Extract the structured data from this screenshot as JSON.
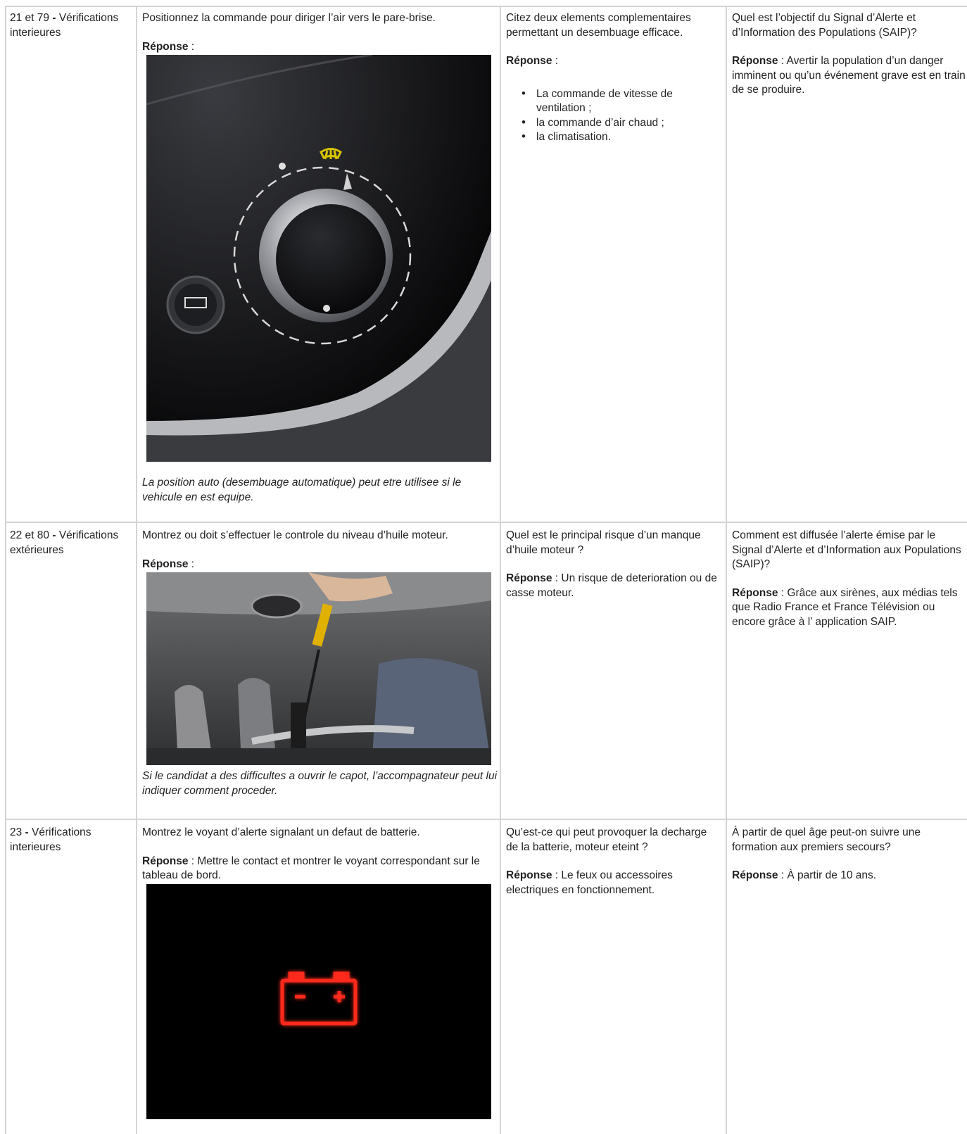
{
  "rows": [
    {
      "section_number": "21 et 79",
      "section_separator": " - ",
      "section_title": "Vérifications interieures",
      "interior_question": "Positionnez la commande pour diriger l’air vers le pare-brise.",
      "answer_label": "Réponse",
      "answer_suffix": " :",
      "image_icon": "defrost-dial-photo-icon",
      "caption": "La position auto (desembuage automatique) peut etre utilisee si le vehicule en est equipe.",
      "tech_question": "Citez deux elements complementaires permettant un desembuage efficace.",
      "tech_answer_label": "Réponse",
      "tech_answer_suffix": " :",
      "tech_answer_items": [
        "La commande de vitesse de ventilation ;",
        "la commande d’air chaud ;",
        "la climatisation."
      ],
      "safety_question": "Quel est l’objectif du Signal d’Alerte et d’Information des Populations (SAIP)?",
      "safety_answer_label": "Réponse",
      "safety_answer_text": " : Avertir la population d’un danger imminent ou qu’un événement grave est en train de se produire."
    },
    {
      "section_number": "22 et 80",
      "section_separator": " - ",
      "section_title": "Vérifications extérieures",
      "interior_question": "Montrez ou doit s’effectuer le controle du niveau d’huile moteur.",
      "answer_label": "Réponse",
      "answer_suffix": " :",
      "image_icon": "engine-oil-dipstick-photo-icon",
      "caption": "Si le candidat a des difficultes a ouvrir le capot, l’accompagnateur peut lui indiquer comment proceder.",
      "tech_question": "Quel est le principal risque d’un manque d’huile moteur ?",
      "tech_answer_label": "Réponse",
      "tech_answer_text": " : Un risque de deterioration ou de casse moteur.",
      "safety_question": "Comment est diffusée l’alerte émise par le Signal d’Alerte et d’Information aux Populations (SAIP)?",
      "safety_answer_label": "Réponse",
      "safety_answer_text": " : Grâce aux sirènes, aux médias tels que Radio France et France Télévision ou encore grâce à l’ application SAIP."
    },
    {
      "section_number": "23",
      "section_separator": " - ",
      "section_title": "Vérifications interieures",
      "interior_question": "Montrez le voyant d’alerte signalant un defaut de batterie.",
      "answer_label": "Réponse",
      "answer_text": " : Mettre le contact et montrer le voyant correspondant sur le tableau de bord.",
      "image_icon": "battery-warning-light-icon",
      "tech_question": "Qu’est-ce qui peut provoquer la decharge de la batterie, moteur eteint ?",
      "tech_answer_label": "Réponse",
      "tech_answer_text": " : Le feux ou accessoires electriques en fonctionnement.",
      "safety_question": "À partir de quel âge peut-on suivre une formation aux premiers secours?",
      "safety_answer_label": "Réponse",
      "safety_answer_text": " : À partir de 10 ans."
    }
  ],
  "colors": {
    "grid_line": "#d4d4d4",
    "text": "#222222",
    "battery_red": "#ff2a1e",
    "defrost_yellow": "#d8c400"
  }
}
